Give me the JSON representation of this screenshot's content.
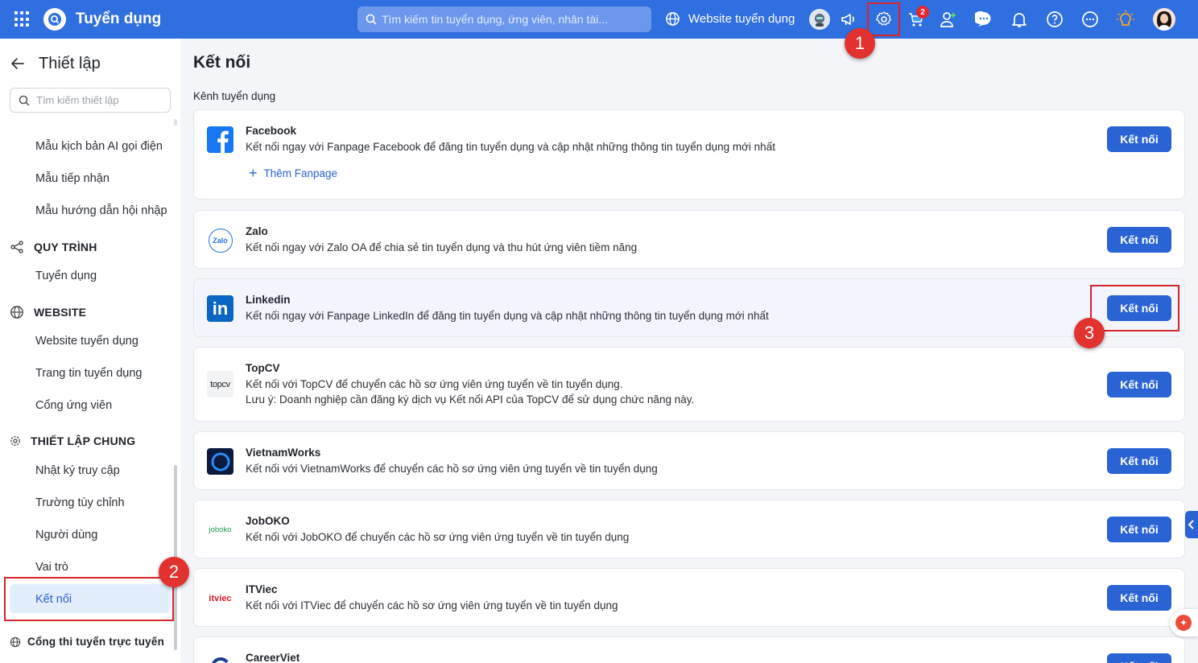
{
  "header": {
    "app_title": "Tuyển dụng",
    "search_placeholder": "Tìm kiếm tin tuyển dụng, ứng viên, nhân tài...",
    "website_link": "Website tuyển dụng",
    "cart_badge": "2",
    "icons": [
      "apps-grid-icon",
      "search-icon",
      "globe-icon",
      "bot-avatar",
      "megaphone-icon",
      "gear-icon",
      "cart-icon",
      "add-user-icon",
      "chat-icon",
      "bell-icon",
      "help-icon",
      "more-icon",
      "lightbulb-icon",
      "user-avatar"
    ]
  },
  "sidebar": {
    "title": "Thiết lập",
    "search_placeholder": "Tìm kiếm thiết lập",
    "items_top": [
      "Mẫu kịch bản AI gọi điện",
      "Mẫu tiếp nhận",
      "Mẫu hướng dẫn hội nhập"
    ],
    "section_process": "QUY TRÌNH",
    "items_process": [
      "Tuyển dụng"
    ],
    "section_website": "WEBSITE",
    "items_website": [
      "Website tuyển dụng",
      "Trang tin tuyển dụng",
      "Cổng ứng viên"
    ],
    "section_general": "THIẾT LẬP CHUNG",
    "items_general": [
      "Nhật ký truy cập",
      "Trường tùy chỉnh",
      "Người dùng",
      "Vai trò",
      "Kết nối"
    ],
    "bottom_item": "Cổng thi tuyển trực tuyến"
  },
  "main": {
    "title": "Kết nối",
    "section_label": "Kênh tuyển dụng",
    "connect_label": "Kết nối",
    "add_fanpage": "Thêm Fanpage",
    "channels": [
      {
        "name": "Facebook",
        "desc": "Kết nối ngay với Fanpage Facebook để đăng tin tuyển dụng và cập nhật những thông tin tuyển dụng mới nhất"
      },
      {
        "name": "Zalo",
        "desc": "Kết nối ngay với Zalo OA để chia sẻ tin tuyển dụng và thu hút ứng viên tiềm năng",
        "logo_text": "Zalo"
      },
      {
        "name": "Linkedin",
        "desc": "Kết nối ngay với Fanpage LinkedIn để đăng tin tuyển dụng và cập nhật những thông tin tuyển dụng mới nhất",
        "logo_text": "in"
      },
      {
        "name": "TopCV",
        "desc": "Kết nối với TopCV để chuyển các hồ sơ ứng viên ứng tuyển về tin tuyển dụng.",
        "note": "Lưu ý: Doanh nghiệp cần đăng ký dịch vụ Kết nối API của TopCV để sử dụng chức năng này.",
        "logo_text": "topcv"
      },
      {
        "name": "VietnamWorks",
        "desc": "Kết nối với VietnamWorks để chuyển các hồ sơ ứng viên ứng tuyển về tin tuyển dụng"
      },
      {
        "name": "JobOKO",
        "desc": "Kết nối với JobOKO để chuyển các hồ sơ ứng viên ứng tuyển về tin tuyển dụng",
        "logo_text": "joboko"
      },
      {
        "name": "ITViec",
        "desc": "Kết nối với ITViec để chuyển các hồ sơ ứng viên ứng tuyển về tin tuyển dụng",
        "logo_text": "itviec"
      },
      {
        "name": "CareerViet",
        "desc": ""
      }
    ]
  },
  "annotations": [
    "1",
    "2",
    "3"
  ],
  "colors": {
    "primary": "#2f6fe0",
    "button": "#2a63d4",
    "annotation": "#e1322f",
    "active_bg": "#e3eefc"
  }
}
